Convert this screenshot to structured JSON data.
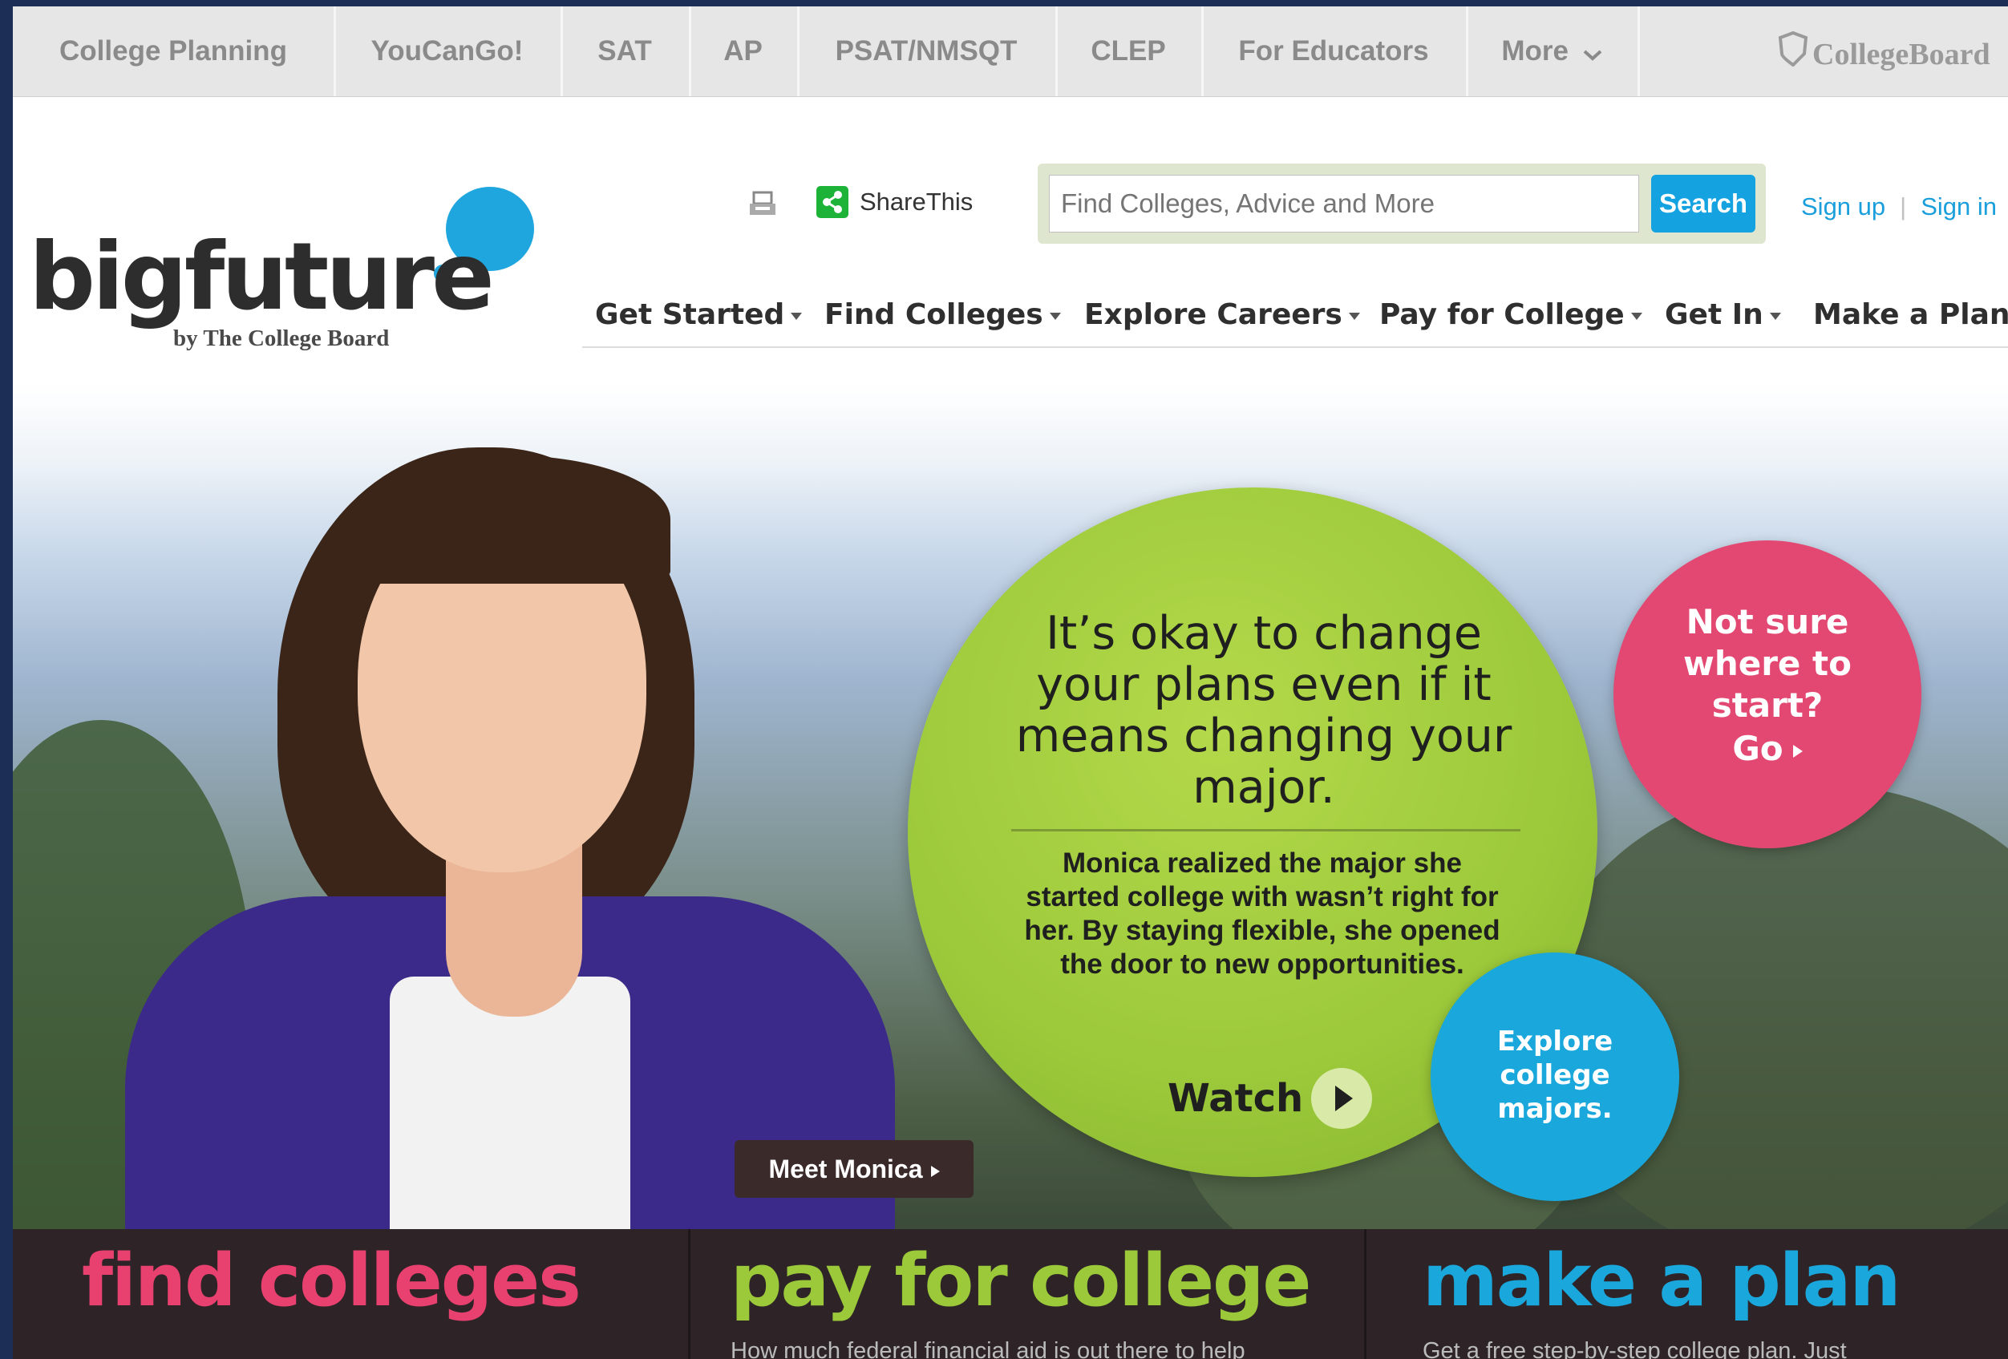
{
  "topbar": {
    "tabs": [
      "College Planning",
      "YouCanGo!",
      "SAT",
      "AP",
      "PSAT/NMSQT",
      "CLEP",
      "For Educators",
      "More"
    ],
    "brand": "CollegeBoard"
  },
  "header": {
    "logo_word": "bigfuture",
    "logo_byline": "by The College Board",
    "share_label": "ShareThis",
    "search_placeholder": "Find Colleges, Advice and More",
    "search_button": "Search",
    "signup": "Sign up",
    "signin": "Sign in"
  },
  "nav": {
    "items": [
      "Get Started",
      "Find Colleges",
      "Explore Careers",
      "Pay for College",
      "Get In",
      "Make a Plan"
    ]
  },
  "carousel": {
    "slide_count": 3,
    "active_index": 0
  },
  "hero": {
    "headline": "It’s okay to change your plans even if it means changing your major.",
    "body": "Monica realized the major she started college with wasn’t right for her. By staying flexible, she opened the door to new opportunities.",
    "watch_label": "Watch",
    "pink_line1": "Not sure",
    "pink_line2": "where to",
    "pink_line3": "start?",
    "pink_go": "Go",
    "blue_line1": "Explore",
    "blue_line2": "college",
    "blue_line3": "majors.",
    "meet_label": "Meet Monica"
  },
  "bottom": {
    "panels": [
      {
        "title": "find colleges",
        "subtitle": "",
        "color": "#e8406f"
      },
      {
        "title": "pay for college",
        "subtitle": "How much federal financial aid is out there to help",
        "color": "#9bc93a"
      },
      {
        "title": "make a plan",
        "subtitle": "Get a free step-by-step college plan. Just",
        "color": "#1aa7dc"
      }
    ]
  },
  "colors": {
    "accent_blue": "#1aa7dc",
    "accent_pink": "#e8406f",
    "accent_green": "#9bc93a"
  }
}
